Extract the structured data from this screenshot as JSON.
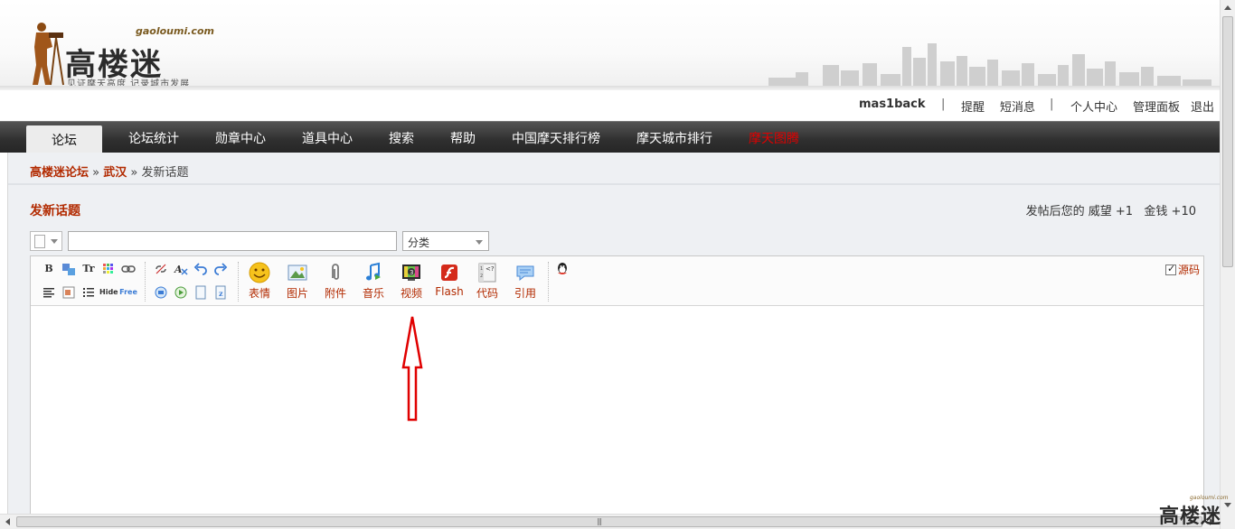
{
  "logo": {
    "brand": "高楼迷",
    "domain": "gaoloumi.com",
    "tagline": "见证摩天高度 记录城市发展"
  },
  "userbar": {
    "username": "mas1back",
    "items": [
      "提醒",
      "短消息",
      "个人中心",
      "管理面板",
      "退出"
    ],
    "separator": "|"
  },
  "nav": {
    "tabs": [
      "论坛",
      "论坛统计",
      "勋章中心",
      "道具中心",
      "搜索",
      "帮助",
      "中国摩天排行榜",
      "摩天城市排行",
      "摩天图腾"
    ],
    "active_index": 0,
    "special_color": "#e00000"
  },
  "breadcrumb": {
    "home": "高楼迷论坛",
    "sep": "»",
    "forum": "武汉",
    "current": "发新话题"
  },
  "post": {
    "title": "发新话题",
    "reward_label": "发帖后您的",
    "reward_prestige": "威望 +1",
    "reward_money": "金钱 +10"
  },
  "form": {
    "subject_value": "",
    "category": "分类"
  },
  "toolbar": {
    "small_row1": [
      "B",
      "color",
      "Tr",
      "grid",
      "link"
    ],
    "small_row2": [
      "align",
      "float",
      "list",
      "Hide",
      "Free"
    ],
    "small2_row1": [
      "unlink",
      "removeformat",
      "undo",
      "redo"
    ],
    "small2_row2": [
      "loginview",
      "play",
      "page",
      "index"
    ],
    "buttons": [
      {
        "label": "表情",
        "icon": "smiley-icon"
      },
      {
        "label": "图片",
        "icon": "image-icon"
      },
      {
        "label": "附件",
        "icon": "paperclip-icon"
      },
      {
        "label": "音乐",
        "icon": "music-icon"
      },
      {
        "label": "视频",
        "icon": "video-icon"
      },
      {
        "label": "Flash",
        "icon": "flash-icon"
      },
      {
        "label": "代码",
        "icon": "code-icon"
      },
      {
        "label": "引用",
        "icon": "quote-icon"
      }
    ],
    "source_label": "源码",
    "source_checked": true
  },
  "colors": {
    "accent": "#b22a00",
    "nav_bg": "#2f2f2f",
    "annotation": "#e00000"
  },
  "watermark": {
    "text": "高楼迷",
    "domain": "gaoloumi.com"
  }
}
